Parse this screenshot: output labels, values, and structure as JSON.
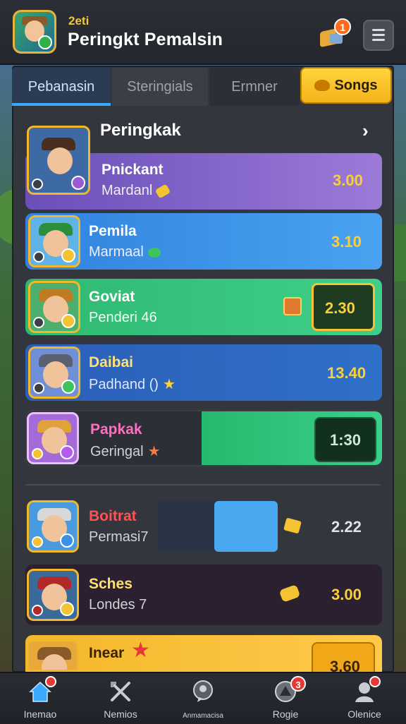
{
  "header": {
    "small_label": "2eti",
    "title": "Peringkt Pemalsin",
    "notification_count": "1"
  },
  "tabs": [
    {
      "label": "Pebanasin",
      "active": true
    },
    {
      "label": "Steringials",
      "active": false
    },
    {
      "label": "Ermner",
      "active": false
    },
    {
      "label": "Songs",
      "highlight": true
    }
  ],
  "section": {
    "title": "Peringkak"
  },
  "rows": [
    {
      "name": "Pnickant",
      "sub": "Mardanl",
      "score": "3.00",
      "colors": {
        "bg": "#8f6ad8",
        "name": "#ffffff"
      }
    },
    {
      "name": "Pemila",
      "sub": "Marmaal",
      "score": "3.10",
      "colors": {
        "bg": "#3a8fe6",
        "name": "#ffffff"
      }
    },
    {
      "name": "Goviat",
      "sub": "Penderi 46",
      "score": "2.30",
      "colors": {
        "bg": "#36c07a",
        "name": "#ffffff"
      }
    },
    {
      "name": "Daibai",
      "sub": "Padhand ()",
      "score": "13.40",
      "colors": {
        "bg": "#2f6fc8",
        "name": "#ffe070"
      }
    },
    {
      "name": "Papkak",
      "sub": "Geringal",
      "score": "1:30",
      "colors": {
        "bg": "#2c2f36",
        "name": "#ff6fbf"
      }
    },
    {
      "name": "Boitrat",
      "sub": "Permasi7",
      "score": "2.22",
      "colors": {
        "bg": "#3a3d44",
        "name": "#ff5252"
      }
    },
    {
      "name": "Sches",
      "sub": "Londes 7",
      "score": "3.00",
      "colors": {
        "bg": "#2a2030",
        "name": "#ffe070"
      }
    },
    {
      "name": "Inear",
      "sub": "",
      "score": "3.60",
      "colors": {
        "bg": "#f3b72a",
        "name": "#3a2200"
      }
    }
  ],
  "nav": [
    {
      "label": "Inemao",
      "icon": "home-icon",
      "badge": "dot"
    },
    {
      "label": "Nemios",
      "icon": "swords-icon",
      "badge": ""
    },
    {
      "label": "Anmamacisa",
      "icon": "chat-icon",
      "badge": ""
    },
    {
      "label": "Rogie",
      "icon": "shield-icon",
      "badge": "3"
    },
    {
      "label": "Olenice",
      "icon": "profile-icon",
      "badge": "dot"
    }
  ],
  "colors": {
    "accent": "#3aa8ff",
    "gold": "#f7d03c",
    "panel": "#33363d"
  }
}
